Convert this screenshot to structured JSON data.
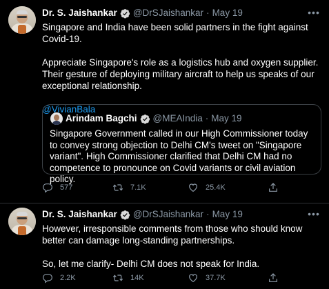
{
  "tweets": [
    {
      "author_name": "Dr. S. Jaishankar",
      "handle": "@DrSJaishankar",
      "separator": "·",
      "date": "May 19",
      "paragraphs": [
        "Singapore and India have been solid partners in the fight against Covid-19.",
        "Appreciate Singapore's role as a logistics hub and oxygen supplier. Their gesture of deploying military aircraft to help us speaks of our exceptional relationship."
      ],
      "mention": "@VivianBala",
      "quote": {
        "author_name": "Arindam Bagchi",
        "handle": "@MEAIndia",
        "separator": "·",
        "date": "May 19",
        "text": "Singapore Government called in our High Commissioner today to convey strong objection to Delhi CM's tweet on \"Singapore variant\". High Commissioner clarified that Delhi CM had no competence to pronounce on Covid variants or civil aviation policy."
      },
      "replies": "577",
      "retweets": "7.1K",
      "likes": "25.4K"
    },
    {
      "author_name": "Dr. S. Jaishankar",
      "handle": "@DrSJaishankar",
      "separator": "·",
      "date": "May 19",
      "paragraphs": [
        "However, irresponsible comments from those who should know better can damage long-standing partnerships.",
        "So, let me clarify- Delhi CM does not speak for India."
      ],
      "replies": "2.2K",
      "retweets": "14K",
      "likes": "37.7K"
    }
  ],
  "colors": {
    "background": "#000000",
    "text": "#ffffff",
    "secondary": "#8b98a5",
    "link": "#1d9bf0",
    "verified": "#1d9bf0",
    "divider": "#2f3336"
  },
  "icons": [
    "verified-badge-icon",
    "more-icon",
    "reply-icon",
    "retweet-icon",
    "like-icon",
    "share-icon"
  ]
}
